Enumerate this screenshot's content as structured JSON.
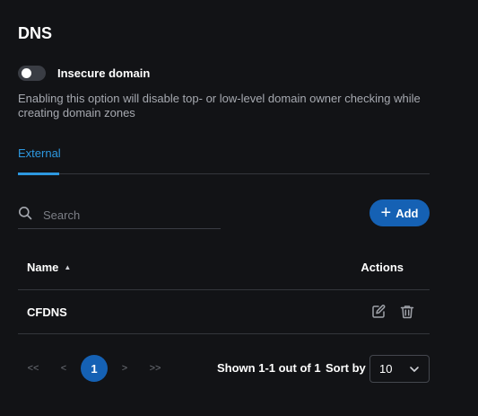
{
  "header": {
    "title": "DNS"
  },
  "toggle": {
    "label": "Insecure domain",
    "checked": false
  },
  "description": "Enabling this option will disable top- or low-level domain owner checking while creating domain zones",
  "tabs": [
    {
      "label": "External",
      "active": true
    }
  ],
  "search": {
    "placeholder": "Search",
    "value": ""
  },
  "toolbar": {
    "add_label": "Add"
  },
  "table": {
    "columns": {
      "name": "Name",
      "actions": "Actions"
    },
    "rows": [
      {
        "name": "CFDNS"
      }
    ]
  },
  "pagination": {
    "first": "<<",
    "prev": "<",
    "current": "1",
    "next": ">",
    "last": ">>",
    "summary": "Shown 1-1 out of 1",
    "sort_label": "Sort by",
    "page_size": "10"
  },
  "colors": {
    "accent": "#1561b4",
    "tab_accent": "#2d98e0",
    "background": "#121316"
  }
}
